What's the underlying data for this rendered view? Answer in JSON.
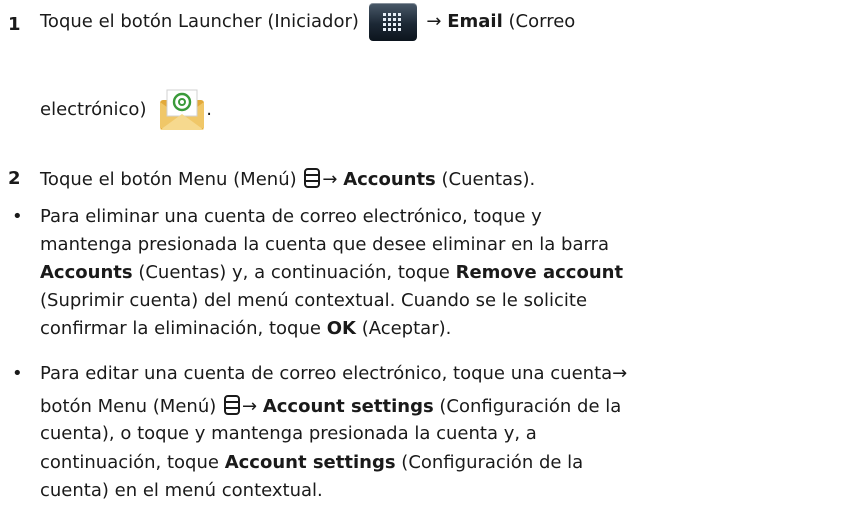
{
  "step1": {
    "num": "1",
    "a": "Toque el botón Launcher (Iniciador)",
    "arrow": "→",
    "b_bold": "Email",
    "c": "(Correo",
    "d": "electrónico)",
    "e": "."
  },
  "step2": {
    "num": "2",
    "a": "Toque el botón Menu (Menú)",
    "arrow": "→",
    "b_bold": "Accounts",
    "c": "(Cuentas)."
  },
  "bullet1": {
    "mark": "•",
    "l1": "Para eliminar una cuenta de correo electrónico, toque y",
    "l2": "mantenga presionada la cuenta que desee eliminar en la barra",
    "l3_bold1": "Accounts",
    "l3_a": "(Cuentas) y, a continuación, toque",
    "l3_bold2": "Remove account",
    "l4": "(Suprimir cuenta) del menú contextual. Cuando se le solicite",
    "l5_a": "confirmar la eliminación, toque",
    "l5_bold": "OK",
    "l5_b": "(Aceptar)."
  },
  "bullet2": {
    "mark": "•",
    "l1_a": "Para editar una cuenta de correo electrónico, toque una cuenta",
    "arrow": "→",
    "l2_a": "botón Menu (Menú)",
    "l2_bold": "Account settings",
    "l2_b": "(Configuración de la",
    "l3": "cuenta), o toque y mantenga presionada la cuenta y, a",
    "l4": "continuación, toque",
    "l4_bold": "Account settings",
    "l4_b": "(Configuración de la",
    "l5": "cuenta) en el menú contextual."
  },
  "icons": {
    "launcher": "launcher-grid-icon",
    "email": "email-envelope-icon",
    "menu": "menu-icon"
  }
}
